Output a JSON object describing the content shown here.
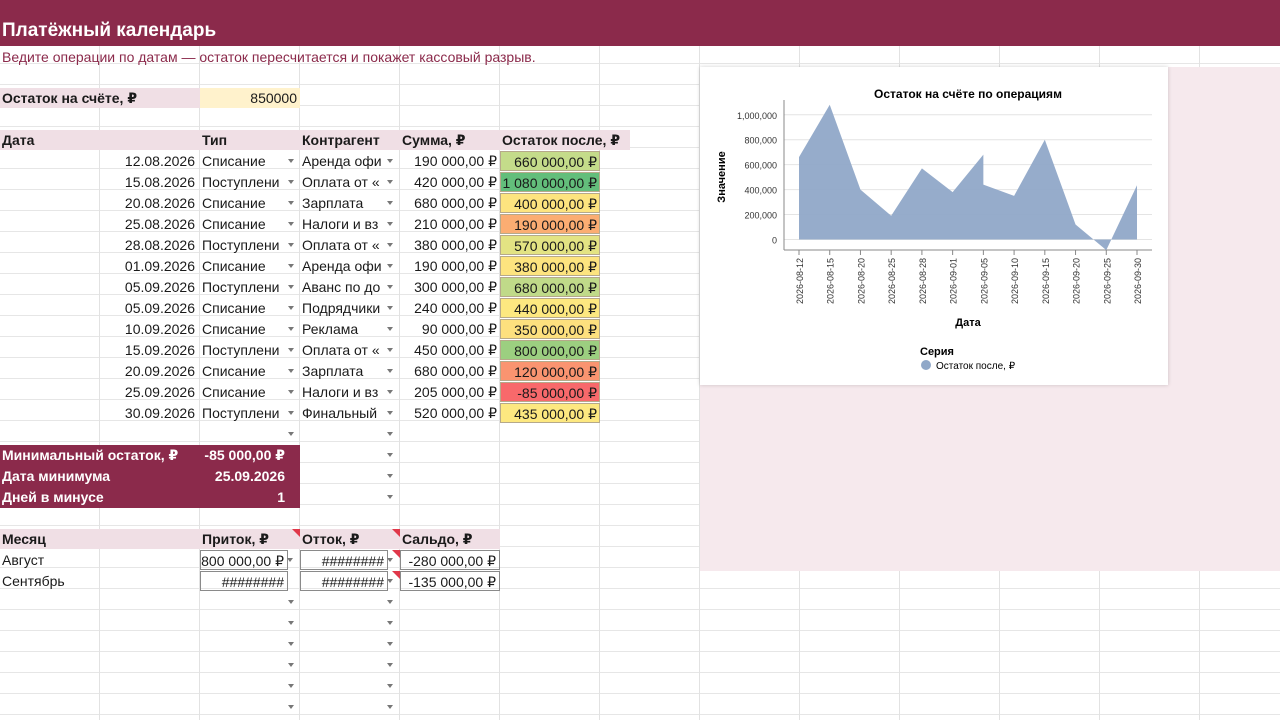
{
  "sheet": {
    "title": "Платёжный календарь",
    "subtitle": "Ведите операции по датам — остаток пересчитается и покажет кассовый разрыв.",
    "balance_label": "Остаток на счёте, ₽",
    "balance_value": "850000"
  },
  "table": {
    "headers": [
      "Дата",
      "Тип",
      "Контрагент",
      "Сумма, ₽",
      "Остаток после, ₽"
    ],
    "rows": [
      {
        "date": "12.08.2026",
        "type": "Списание",
        "party": "Аренда офи",
        "amount": "190 000,00 ₽",
        "balance": "660 000,00 ₽",
        "color": "#c4dc8a"
      },
      {
        "date": "15.08.2026",
        "type": "Поступлени",
        "party": "Оплата от «",
        "amount": "420 000,00 ₽",
        "balance": "1 080 000,00 ₽",
        "color": "#63be7b"
      },
      {
        "date": "20.08.2026",
        "type": "Списание",
        "party": "Зарплата",
        "amount": "680 000,00 ₽",
        "balance": "400 000,00 ₽",
        "color": "#fde47f"
      },
      {
        "date": "25.08.2026",
        "type": "Списание",
        "party": "Налоги и вз",
        "amount": "210 000,00 ₽",
        "balance": "190 000,00 ₽",
        "color": "#fbad72"
      },
      {
        "date": "28.08.2026",
        "type": "Поступлени",
        "party": "Оплата от «",
        "amount": "380 000,00 ₽",
        "balance": "570 000,00 ₽",
        "color": "#e3e383"
      },
      {
        "date": "01.09.2026",
        "type": "Списание",
        "party": "Аренда офи",
        "amount": "190 000,00 ₽",
        "balance": "380 000,00 ₽",
        "color": "#fde47f"
      },
      {
        "date": "05.09.2026",
        "type": "Поступлени",
        "party": "Аванс по до",
        "amount": "300 000,00 ₽",
        "balance": "680 000,00 ₽",
        "color": "#c0da89"
      },
      {
        "date": "05.09.2026",
        "type": "Списание",
        "party": "Подрядчики",
        "amount": "240 000,00 ₽",
        "balance": "440 000,00 ₽",
        "color": "#fde880"
      },
      {
        "date": "10.09.2026",
        "type": "Списание",
        "party": "Реклама",
        "amount": "90 000,00 ₽",
        "balance": "350 000,00 ₽",
        "color": "#fde07e"
      },
      {
        "date": "15.09.2026",
        "type": "Поступлени",
        "party": "Оплата от «",
        "amount": "450 000,00 ₽",
        "balance": "800 000,00 ₽",
        "color": "#9ccf80"
      },
      {
        "date": "20.09.2026",
        "type": "Списание",
        "party": "Зарплата",
        "amount": "680 000,00 ₽",
        "balance": "120 000,00 ₽",
        "color": "#fa9470"
      },
      {
        "date": "25.09.2026",
        "type": "Списание",
        "party": "Налоги и вз",
        "amount": "205 000,00 ₽",
        "balance": "-85 000,00 ₽",
        "color": "#f8696b"
      },
      {
        "date": "30.09.2026",
        "type": "Поступлени",
        "party": "Финальный",
        "amount": "520 000,00 ₽",
        "balance": "435 000,00 ₽",
        "color": "#fde880"
      }
    ]
  },
  "summary": [
    {
      "label": "Минимальный остаток, ₽",
      "value": "-85 000,00 ₽"
    },
    {
      "label": "Дата минимума",
      "value": "25.09.2026"
    },
    {
      "label": "Дней в минусе",
      "value": "1"
    }
  ],
  "monthly": {
    "headers": [
      "Месяц",
      "Приток, ₽",
      "Отток, ₽",
      "Сальдо, ₽"
    ],
    "rows": [
      {
        "month": "Август",
        "inflow": "800 000,00 ₽",
        "outflow": "########",
        "saldo": "-280 000,00 ₽"
      },
      {
        "month": "Сентябрь",
        "inflow": "########",
        "outflow": "########",
        "saldo": "-135 000,00 ₽"
      }
    ]
  },
  "chart_data": {
    "type": "area",
    "title": "Остаток на счёте по операциям",
    "xlabel": "Дата",
    "ylabel": "Значение",
    "x_ticks": [
      "2026-08-12",
      "2026-08-15",
      "2026-08-20",
      "2026-08-25",
      "2026-08-28",
      "2026-09-01",
      "2026-09-05",
      "2026-09-10",
      "2026-09-15",
      "2026-09-20",
      "2026-09-25",
      "2026-09-30"
    ],
    "y_ticks": [
      "1,000,000",
      "800,000",
      "600,000",
      "400,000",
      "200,000",
      "0"
    ],
    "ylim": [
      -85000,
      1080000
    ],
    "legend_title": "Серия",
    "color": "#90a8c8",
    "series": [
      {
        "name": "Остаток после, ₽",
        "points": [
          [
            "2026-08-12",
            660000
          ],
          [
            "2026-08-15",
            1080000
          ],
          [
            "2026-08-20",
            400000
          ],
          [
            "2026-08-25",
            190000
          ],
          [
            "2026-08-28",
            570000
          ],
          [
            "2026-09-01",
            380000
          ],
          [
            "2026-09-05",
            680000
          ],
          [
            "2026-09-05",
            440000
          ],
          [
            "2026-09-10",
            350000
          ],
          [
            "2026-09-15",
            800000
          ],
          [
            "2026-09-20",
            120000
          ],
          [
            "2026-09-25",
            -85000
          ],
          [
            "2026-09-30",
            435000
          ]
        ]
      }
    ]
  }
}
